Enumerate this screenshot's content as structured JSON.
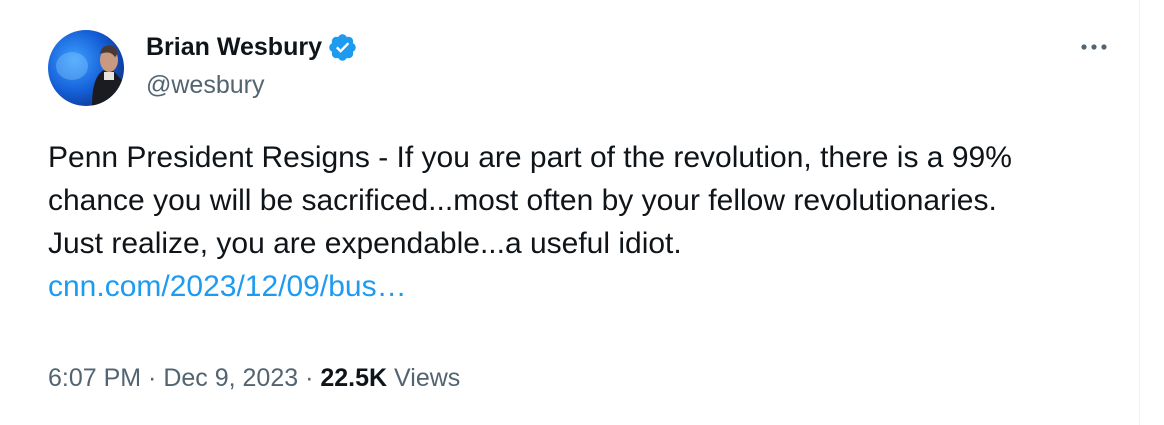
{
  "author": {
    "display_name": "Brian Wesbury",
    "handle": "@wesbury",
    "verified": true
  },
  "icons": {
    "verified": "verified-badge-icon",
    "more": "more-options-icon"
  },
  "tweet": {
    "text_lines": [
      "Penn President Resigns - If you are part of the revolution, there is a 99%",
      "chance you will be sacrificed...most often by your fellow revolutionaries.",
      "Just realize, you are expendable...a useful idiot."
    ],
    "link": "cnn.com/2023/12/09/bus…"
  },
  "meta": {
    "time": "6:07 PM",
    "sep1": " · ",
    "date": "Dec 9, 2023",
    "sep2": " · ",
    "views_count": "22.5K",
    "views_label": " Views"
  },
  "colors": {
    "text": "#0f1419",
    "secondary": "#536471",
    "link": "#1d9bf0",
    "verified": "#1d9bf0"
  }
}
